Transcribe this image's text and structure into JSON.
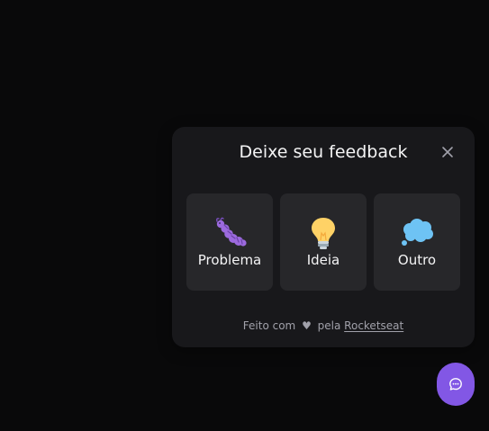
{
  "widget": {
    "title": "Deixe seu feedback",
    "close_icon": "close-icon",
    "types": [
      {
        "label": "Problema",
        "icon": "bug-icon"
      },
      {
        "label": "Ideia",
        "icon": "lightbulb-icon"
      },
      {
        "label": "Outro",
        "icon": "thought-bubble-icon"
      }
    ],
    "footer": {
      "prefix": "Feito com",
      "heart": "♥",
      "middle": "pela",
      "link": "Rocketseat"
    }
  },
  "fab": {
    "icon": "chat-icon"
  },
  "colors": {
    "background": "#09090a",
    "surface": "#18181b",
    "card": "#27272a",
    "brand": "#8257e5",
    "text": "#f4f4f5",
    "muted": "#a1a1aa"
  }
}
